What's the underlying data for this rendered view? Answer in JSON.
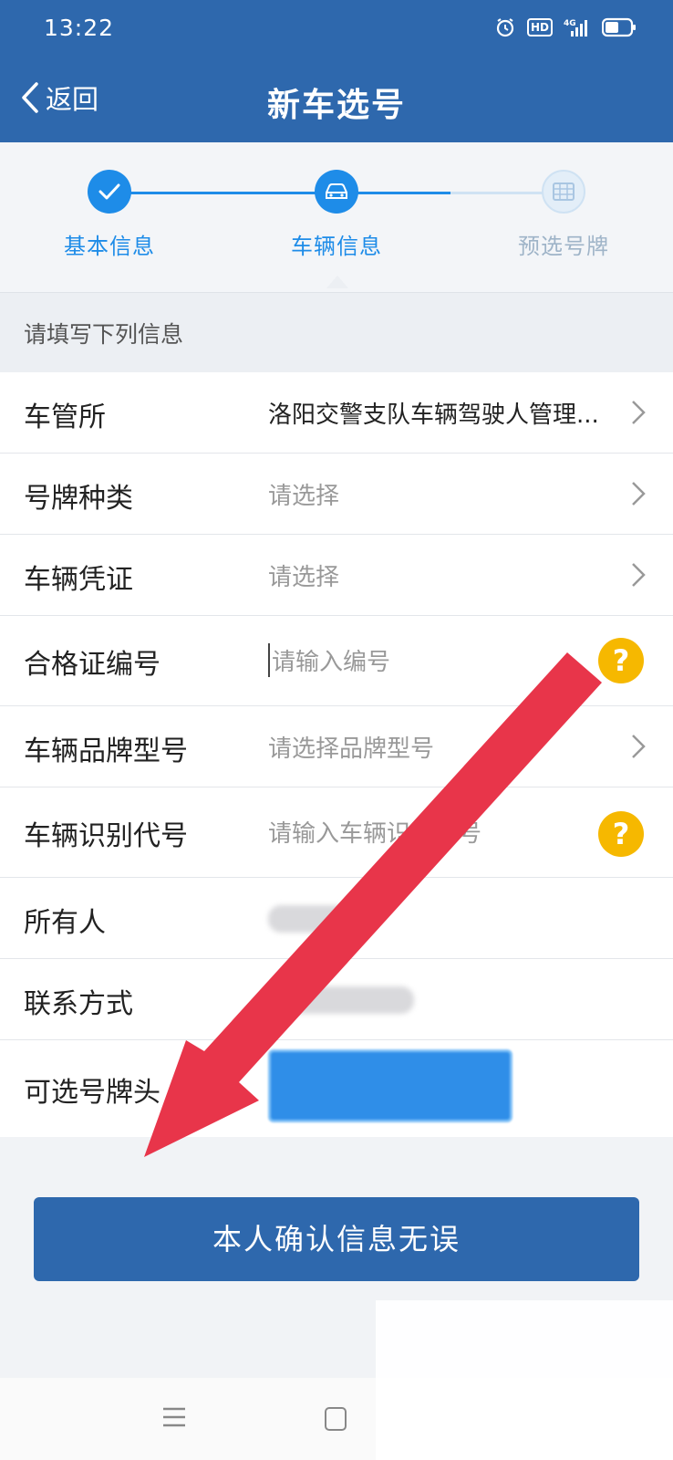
{
  "status_bar": {
    "time": "13:22",
    "icons": [
      "alarm-icon",
      "hd-icon",
      "4g-signal-icon",
      "battery-icon"
    ],
    "hd": "HD",
    "network": "4G"
  },
  "nav": {
    "back_label": "返回",
    "title": "新车选号"
  },
  "stepper": {
    "steps": [
      {
        "label": "基本信息",
        "state": "completed",
        "icon": "check-icon"
      },
      {
        "label": "车辆信息",
        "state": "current",
        "icon": "car-icon"
      },
      {
        "label": "预选号牌",
        "state": "pending",
        "icon": "plate-icon"
      }
    ]
  },
  "form": {
    "hint": "请填写下列信息",
    "rows": [
      {
        "label": "车管所",
        "value": "洛阳交警支队车辆驾驶人管理..."
      },
      {
        "label": "号牌种类",
        "value": "请选择"
      },
      {
        "label": "车辆凭证",
        "value": "请选择"
      },
      {
        "label": "合格证编号",
        "placeholder": "请输入编号",
        "help": "?"
      },
      {
        "label": "车辆品牌型号",
        "value": "请选择品牌型号"
      },
      {
        "label": "车辆识别代号",
        "placeholder": "请输入车辆识别代号",
        "help": "?"
      },
      {
        "label": "所有人"
      },
      {
        "label": "联系方式"
      },
      {
        "label": "可选号牌头"
      }
    ]
  },
  "confirm_button": {
    "label": "本人确认信息无误"
  },
  "colors": {
    "brand": "#2e68ad",
    "accent": "#1e8ce8",
    "help": "#f6b800",
    "arrow": "#e8354a"
  }
}
